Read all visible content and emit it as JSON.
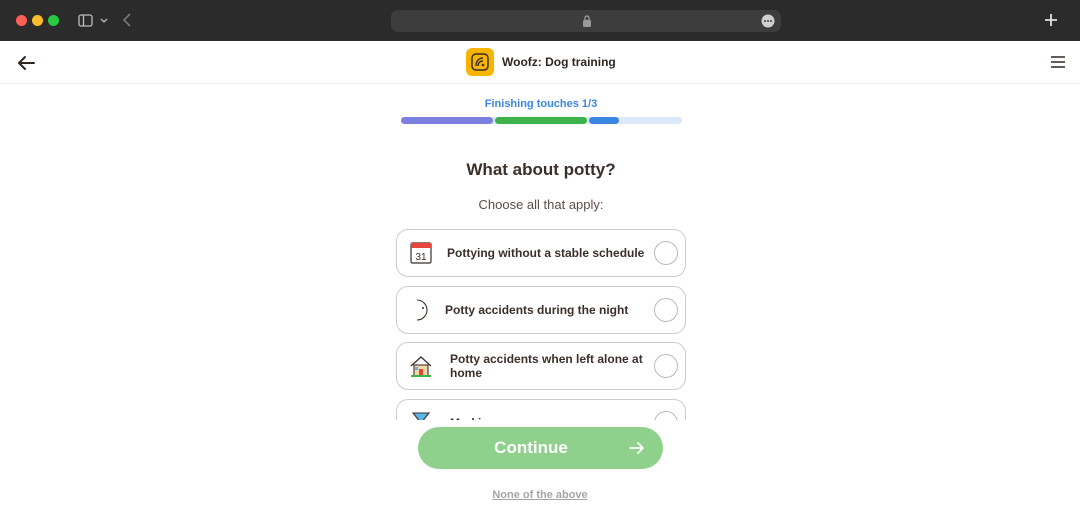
{
  "browser": {
    "icons": [
      "sidebar-toggle-icon",
      "chevron-down-icon",
      "back-chevron-icon",
      "lock-icon",
      "more-dots-icon",
      "new-tab-plus-icon"
    ]
  },
  "header": {
    "app_name": "Woofz: Dog training",
    "logo_color": "#f7b500"
  },
  "progress": {
    "label": "Finishing touches 1/3",
    "label_color": "#3a86e0",
    "segments": [
      {
        "color": "#7b7fe0",
        "fill": 1.0
      },
      {
        "color": "#3db34a",
        "fill": 1.0
      },
      {
        "color": "#3a86e0",
        "fill": 0.33
      }
    ],
    "track_color": "#dde8fb"
  },
  "question": {
    "title": "What about potty?",
    "subtitle": "Choose all that apply:"
  },
  "options": [
    {
      "label": "Pottying without a stable schedule",
      "icon": "calendar-icon",
      "icon_text": "31",
      "selected": false
    },
    {
      "label": "Potty accidents during the night",
      "icon": "crescent-moon-icon",
      "selected": false
    },
    {
      "label": "Potty accidents when left alone at home",
      "icon": "house-icon",
      "selected": false
    },
    {
      "label": "Marking",
      "icon": "hourglass-icon",
      "selected": false
    }
  ],
  "actions": {
    "continue_label": "Continue",
    "continue_color": "#8fd18c",
    "none_label": "None of the above"
  }
}
